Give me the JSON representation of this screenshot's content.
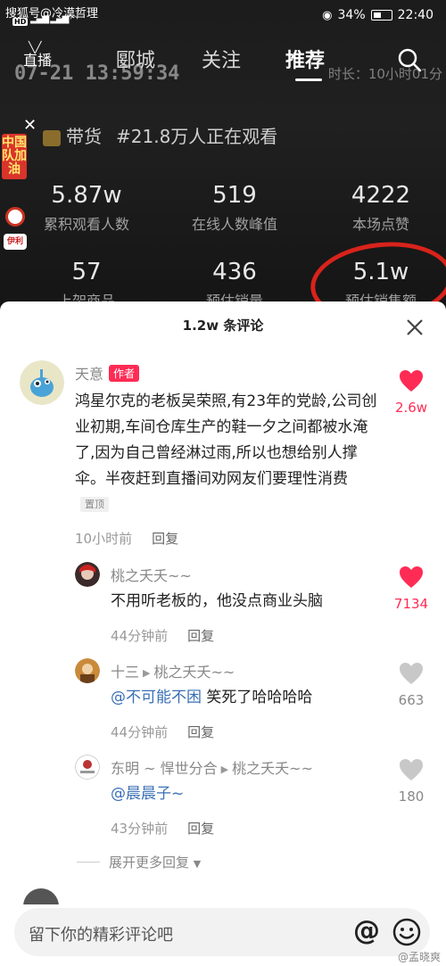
{
  "status_bar": {
    "left_text": "搜狐号@冷漠哲理",
    "hd": "HD",
    "battery": "34%",
    "time": "22:40"
  },
  "video_overlay": {
    "timestamp": "07-21 13:59:34",
    "duration": "时长：10小时01分"
  },
  "top_nav": {
    "live_label": "直播",
    "tabs": [
      "郾城",
      "关注",
      "推荐"
    ],
    "active_tab": "推荐"
  },
  "side_badge": {
    "text": "中国队加油",
    "logo_text": "伊利"
  },
  "live_info": {
    "goods_label": "带货",
    "watching": "#21.8万人正在观看",
    "stats": [
      {
        "value": "5.87w",
        "label": "累积观看人数"
      },
      {
        "value": "519",
        "label": "在线人数峰值"
      },
      {
        "value": "4222",
        "label": "本场点赞"
      },
      {
        "value": "57",
        "label": "上架商品"
      },
      {
        "value": "436",
        "label": "预估销量"
      },
      {
        "value": "5.1w",
        "label": "预估销售额"
      }
    ]
  },
  "comments_sheet": {
    "title": "1.2w 条评论",
    "main_comment": {
      "user": "天意",
      "author_tag": "作者",
      "text": "鸿星尔克的老板吴荣照,有23年的党龄,公司创业初期,车间仓库生产的鞋一夕之间都被水淹了,因为自己曾经淋过雨,所以也想给别人撑伞。半夜赶到直播间劝网友们要理性消费",
      "pinned_tag": "置顶",
      "time": "10小时前",
      "reply_label": "回复",
      "likes": "2.6w"
    },
    "replies": [
      {
        "user": "桃之夭夭~~",
        "reply_to": "",
        "mention": "",
        "text": "不用听老板的，他没点商业头脑",
        "time": "44分钟前",
        "reply_label": "回复",
        "likes": "7134",
        "liked": true
      },
      {
        "user": "十三",
        "reply_to": "桃之夭夭~~",
        "mention": "@不可能不困",
        "text": " 笑死了哈哈哈哈",
        "time": "44分钟前",
        "reply_label": "回复",
        "likes": "663",
        "liked": false
      },
      {
        "user": "东明 ~ 悍世分合",
        "reply_to": "桃之夭夭~~",
        "mention": "@晨晨子~",
        "text": "",
        "time": "43分钟前",
        "reply_label": "回复",
        "likes": "180",
        "liked": false
      }
    ],
    "expand_label": "展开更多回复",
    "input_placeholder": "留下你的精彩评论吧"
  },
  "watermark": "@孟晓爽",
  "colors": {
    "like_red": "#fe2c55",
    "mention_blue": "#3a6fb5",
    "circle_red": "#d8231b"
  }
}
